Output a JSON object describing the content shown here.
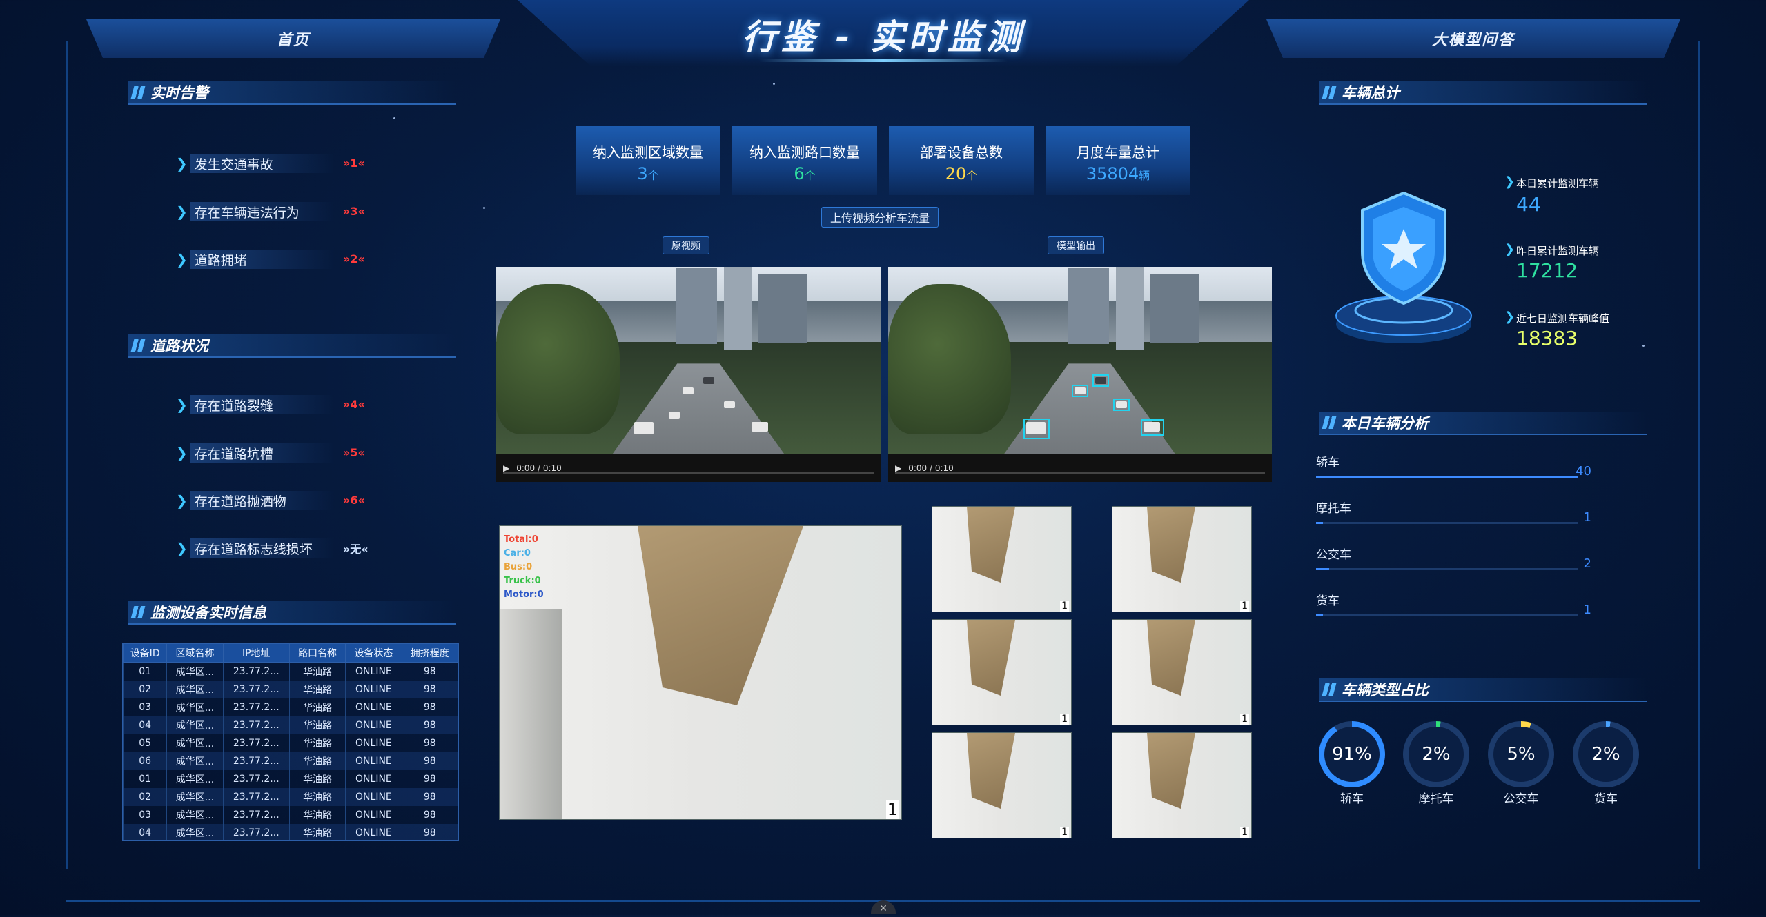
{
  "header": {
    "left_tab": "首页",
    "title": "行鉴 - 实时监测",
    "right_tab": "大模型问答"
  },
  "alerts": {
    "title": "实时告警",
    "items": [
      {
        "label": "发生交通事故",
        "count": "1"
      },
      {
        "label": "存在车辆违法行为",
        "count": "3"
      },
      {
        "label": "道路拥堵",
        "count": "2"
      }
    ]
  },
  "road_status": {
    "title": "道路状况",
    "items": [
      {
        "label": "存在道路裂缝",
        "count": "4"
      },
      {
        "label": "存在道路坑槽",
        "count": "5"
      },
      {
        "label": "存在道路抛洒物",
        "count": "6"
      },
      {
        "label": "存在道路标志线损坏",
        "count": "无"
      }
    ]
  },
  "devices": {
    "title": "监测设备实时信息",
    "columns": [
      "设备ID",
      "区域名称",
      "IP地址",
      "路口名称",
      "设备状态",
      "拥挤程度"
    ],
    "rows": [
      [
        "01",
        "成华区...",
        "23.77.2...",
        "华油路",
        "ONLINE",
        "98"
      ],
      [
        "02",
        "成华区...",
        "23.77.2...",
        "华油路",
        "ONLINE",
        "98"
      ],
      [
        "03",
        "成华区...",
        "23.77.2...",
        "华油路",
        "ONLINE",
        "98"
      ],
      [
        "04",
        "成华区...",
        "23.77.2...",
        "华油路",
        "ONLINE",
        "98"
      ],
      [
        "05",
        "成华区...",
        "23.77.2...",
        "华油路",
        "ONLINE",
        "98"
      ],
      [
        "06",
        "成华区...",
        "23.77.2...",
        "华油路",
        "ONLINE",
        "98"
      ],
      [
        "01",
        "成华区...",
        "23.77.2...",
        "华油路",
        "ONLINE",
        "98"
      ],
      [
        "02",
        "成华区...",
        "23.77.2...",
        "华油路",
        "ONLINE",
        "98"
      ],
      [
        "03",
        "成华区...",
        "23.77.2...",
        "华油路",
        "ONLINE",
        "98"
      ],
      [
        "04",
        "成华区...",
        "23.77.2...",
        "华油路",
        "ONLINE",
        "98"
      ]
    ]
  },
  "stats": [
    {
      "label": "纳入监测区域数量",
      "value": "3",
      "unit": "个",
      "color": "#3da9ff"
    },
    {
      "label": "纳入监测路口数量",
      "value": "6",
      "unit": "个",
      "color": "#2fe0a0"
    },
    {
      "label": "部署设备总数",
      "value": "20",
      "unit": "个",
      "color": "#ffd84a"
    },
    {
      "label": "月度车量总计",
      "value": "35804",
      "unit": "辆",
      "color": "#3da9ff"
    }
  ],
  "upload_button": "上传视频分析车流量",
  "video": {
    "original_label": "原视频",
    "model_label": "模型输出",
    "time": "0:00 / 0:10"
  },
  "detection_overlay": [
    "Total:0",
    "Car:0",
    "Bus:0",
    "Truck:0",
    "Motor:0"
  ],
  "camera_labels": [
    "1",
    "1",
    "1",
    "1",
    "1",
    "1",
    "1"
  ],
  "vehicle_total": {
    "title": "车辆总计",
    "items": [
      {
        "label": "本日累计监测车辆",
        "value": "44",
        "color": "#3da9ff"
      },
      {
        "label": "昨日累计监测车辆",
        "value": "17212",
        "color": "#2fe0a0"
      },
      {
        "label": "近七日监测车辆峰值",
        "value": "18383",
        "color": "#e8ff6a"
      }
    ]
  },
  "vehicle_analysis": {
    "title": "本日车辆分析",
    "max": 40,
    "items": [
      {
        "label": "轿车",
        "value": "40"
      },
      {
        "label": "摩托车",
        "value": "1"
      },
      {
        "label": "公交车",
        "value": "2"
      },
      {
        "label": "货车",
        "value": "1"
      }
    ]
  },
  "vehicle_share": {
    "title": "车辆类型占比",
    "items": [
      {
        "label": "轿车",
        "percent": "91%",
        "fraction": 0.91,
        "color": "#2f8cff"
      },
      {
        "label": "摩托车",
        "percent": "2%",
        "fraction": 0.02,
        "color": "#2fe07a"
      },
      {
        "label": "公交车",
        "percent": "5%",
        "fraction": 0.05,
        "color": "#ffd84a"
      },
      {
        "label": "货车",
        "percent": "2%",
        "fraction": 0.02,
        "color": "#4aa3ff"
      }
    ]
  },
  "icons": {
    "chevron": "chevron-right-icon",
    "shield": "shield-star-icon",
    "close": "close-icon"
  }
}
